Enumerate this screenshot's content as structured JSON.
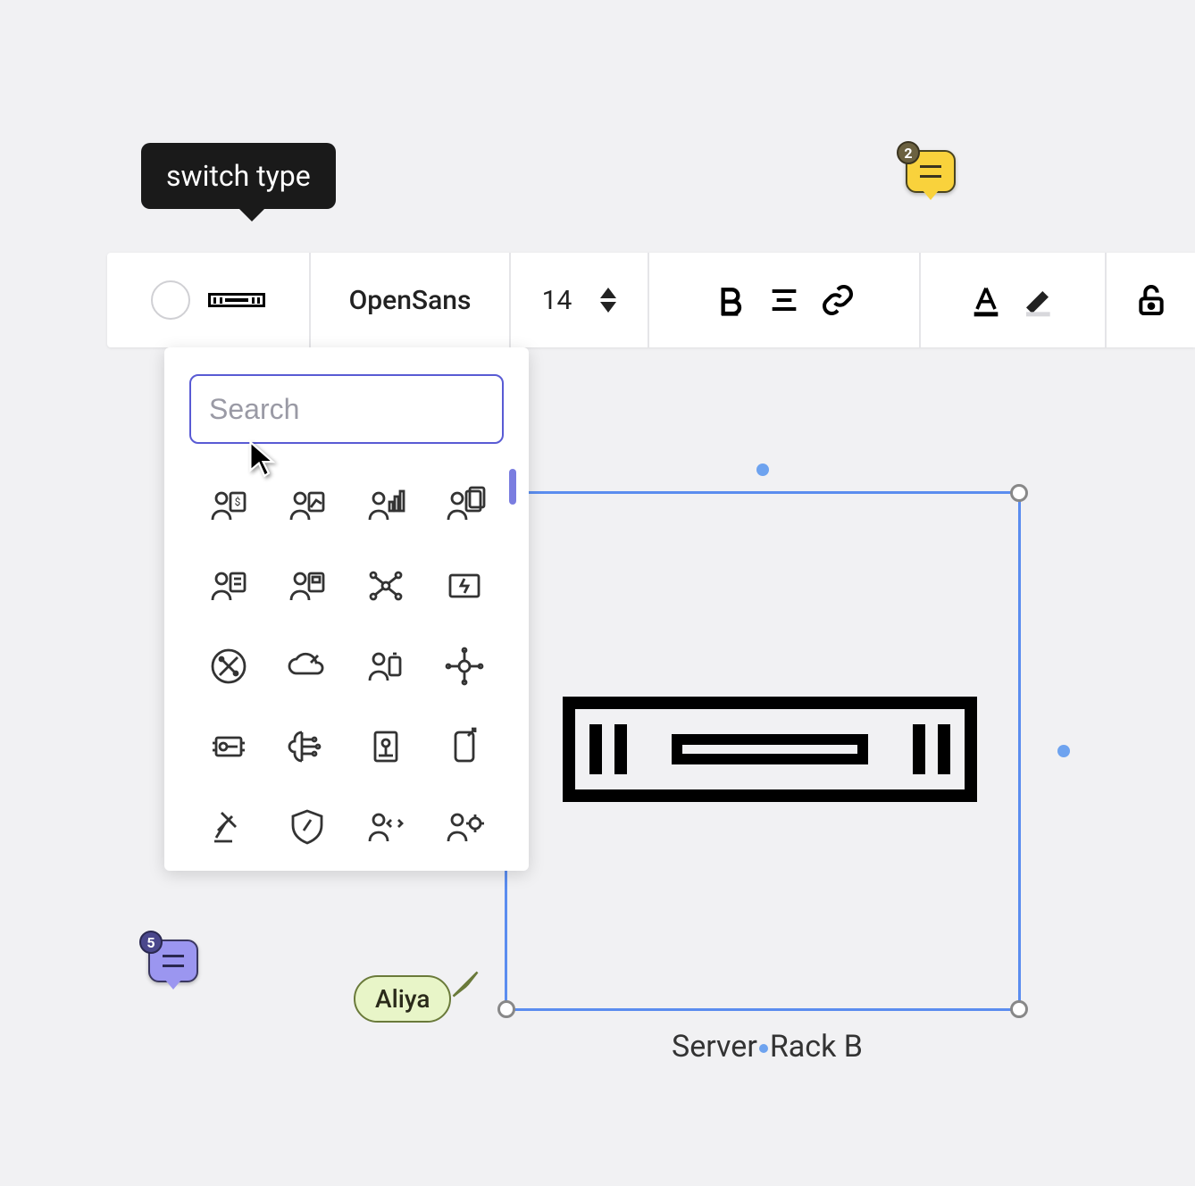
{
  "tooltip": {
    "text": "switch type"
  },
  "toolbar": {
    "font_name": "OpenSans",
    "font_size": "14"
  },
  "dropdown": {
    "search_placeholder": "Search",
    "icons": [
      "user-money-icon",
      "user-chart-icon",
      "user-bars-icon",
      "user-stack-icon",
      "user-list-icon",
      "user-board-icon",
      "network-spark-icon",
      "power-box-icon",
      "wrench-circle-icon",
      "cloud-up-icon",
      "user-battery-icon",
      "neural-node-icon",
      "chip-board-icon",
      "brain-circuit-icon",
      "book-circuit-icon",
      "phone-transfer-icon",
      "gavel-icon",
      "shield-up-icon",
      "user-code-icon",
      "user-gear-icon"
    ]
  },
  "canvas": {
    "selected_shape_label": "Server Rack B"
  },
  "comments": {
    "yellow_count": "2",
    "purple_count": "5"
  },
  "collaborator": {
    "name": "Aliya"
  }
}
